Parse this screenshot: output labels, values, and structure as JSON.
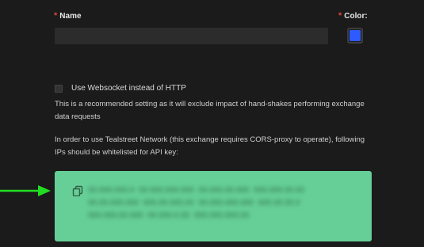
{
  "name_field": {
    "required_marker": "*",
    "label": "Name",
    "value": "",
    "placeholder": ""
  },
  "color_field": {
    "required_marker": "*",
    "label": "Color:",
    "value": "#2e5bff"
  },
  "websocket": {
    "checked": false,
    "label": "Use Websocket instead of HTTP",
    "description": "This is a recommended setting as it will exclude impact of hand-shakes performing exchange data requests"
  },
  "network_notice": "In order to use Tealstreet Network (this exchange requires CORS-proxy to operate), following IPs should be whitelisted for API key:",
  "ip_box": {
    "icon": "copy-icon",
    "background": "#66cf98",
    "text": "00.000.000.0 00.000.000.000 00.000.00.000 000.000.00.00 00.00.000.000 000.00.000.00 00.000.000.000 000.00.00.0 000.000.00.000 00.000.0.00 000.000.000.00"
  },
  "annotation": {
    "icon": "arrow-right-icon",
    "color": "#22dd22"
  }
}
